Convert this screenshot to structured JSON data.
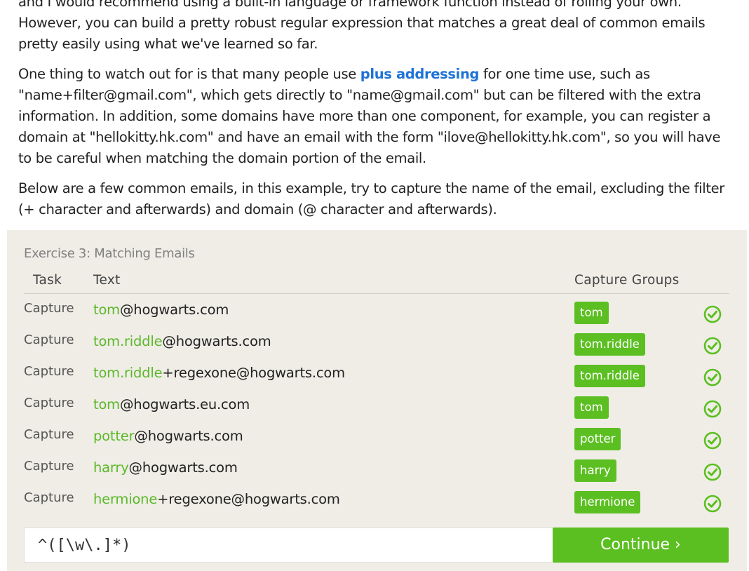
{
  "article": {
    "p1_line1": "and I would recommend using a built-in language or framework function instead of rolling your own.",
    "p1_line2": "However, you can build a pretty robust regular expression that matches a great deal of common emails",
    "p1_line3": "pretty easily using what we've learned so far.",
    "p2_before": "One thing to watch out for is that many people use ",
    "p2_link": "plus addressing",
    "p2_after": " for one time use, such as \"name+filter@gmail.com\", which gets directly to \"name@gmail.com\" but can be filtered with the extra information. In addition, some domains have more than one component, for example, you can register a domain at \"hellokitty.hk.com\" and have an email with the form \"ilove@hellokitty.hk.com\", so you will have to be careful when matching the domain portion of the email.",
    "p3": "Below are a few common emails, in this example, try to capture the name of the email, excluding the filter (+ character and afterwards) and domain (@ character and afterwards)."
  },
  "exercise": {
    "title": "Exercise 3: Matching Emails",
    "headers": {
      "task": "Task",
      "text": "Text",
      "capture_groups": "Capture Groups"
    },
    "rows": [
      {
        "task": "Capture",
        "match": "tom",
        "rest": "@hogwarts.com",
        "group": "tom"
      },
      {
        "task": "Capture",
        "match": "tom.riddle",
        "rest": "@hogwarts.com",
        "group": "tom.riddle"
      },
      {
        "task": "Capture",
        "match": "tom.riddle",
        "rest": "+regexone@hogwarts.com",
        "group": "tom.riddle"
      },
      {
        "task": "Capture",
        "match": "tom",
        "rest": "@hogwarts.eu.com",
        "group": "tom"
      },
      {
        "task": "Capture",
        "match": "potter",
        "rest": "@hogwarts.com",
        "group": "potter"
      },
      {
        "task": "Capture",
        "match": "harry",
        "rest": "@hogwarts.com",
        "group": "harry"
      },
      {
        "task": "Capture",
        "match": "hermione",
        "rest": "+regexone@hogwarts.com",
        "group": "hermione"
      }
    ],
    "status_icon": "check-circle-icon",
    "regex_value": "^([\\w\\.]*)",
    "continue_label": "Continue ›"
  },
  "colors": {
    "accent_green": "#5bbf21",
    "match_green": "#5cb82a",
    "link_blue": "#1f73d6",
    "panel_bg": "#efede6"
  }
}
